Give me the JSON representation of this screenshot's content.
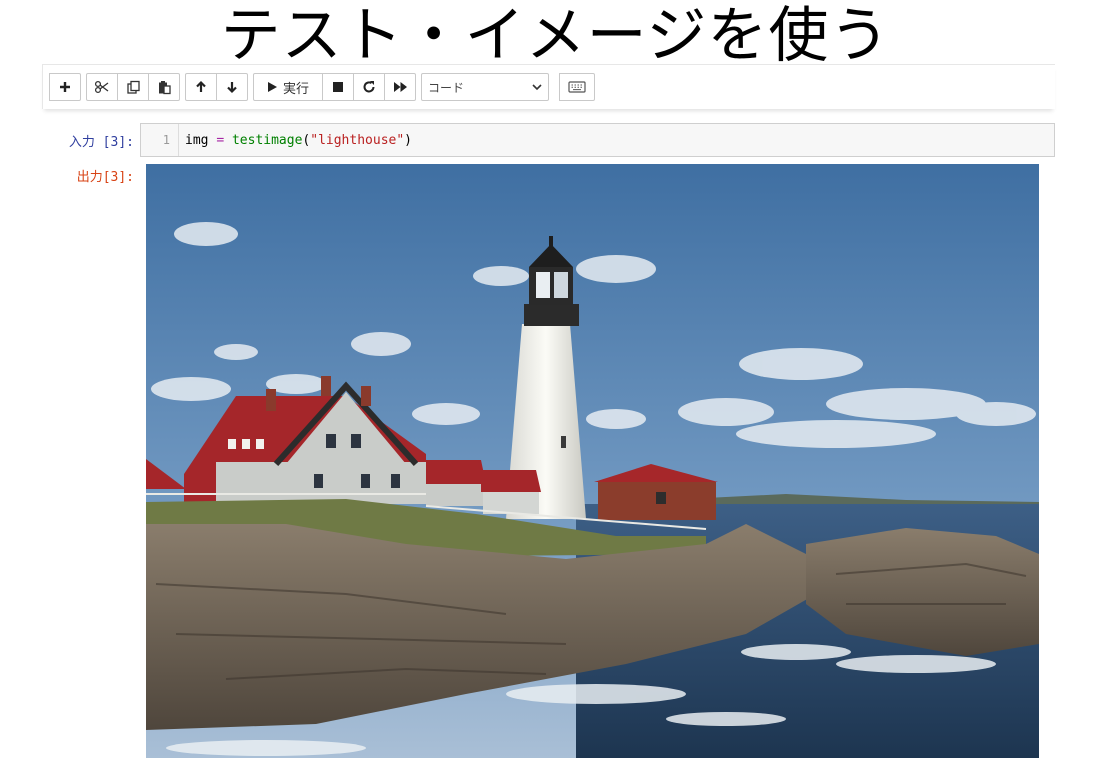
{
  "slide": {
    "title": "テスト・イメージを使う"
  },
  "toolbar": {
    "buttons": {
      "insert": "plus-icon",
      "cut": "scissors-icon",
      "copy": "copy-icon",
      "paste": "paste-icon",
      "move_up": "arrow-up-icon",
      "move_down": "arrow-down-icon",
      "stop": "stop-icon",
      "restart": "restart-icon",
      "restart_run_all": "fast-forward-icon",
      "command_palette": "keyboard-icon"
    },
    "run_label": "実行",
    "cell_type_value": "コード"
  },
  "cell": {
    "input_prompt": "入力 [3]:",
    "line_number": "1",
    "code": {
      "var": "img",
      "op": "=",
      "func": "testimage",
      "open_paren": "(",
      "string": "\"lighthouse\"",
      "close_paren": ")"
    },
    "output_prompt": "出力[3]:"
  },
  "colors": {
    "input_prompt": "#303f9f",
    "output_prompt": "#d84315",
    "code_function": "#008000",
    "code_string": "#ba2121",
    "code_operator": "#a626a4"
  }
}
